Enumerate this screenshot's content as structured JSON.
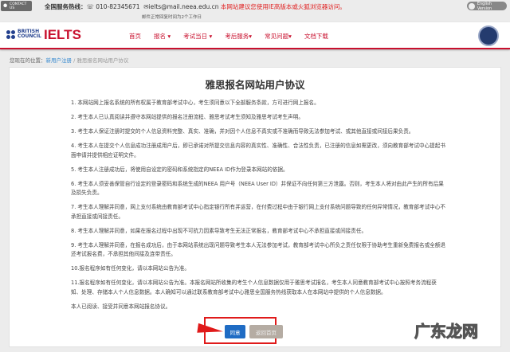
{
  "topbar": {
    "contact": "CONTACT US",
    "hotline_label": "全国服务热线：",
    "phone": "010-82345671",
    "email": "ielts@mail.neea.edu.cn",
    "browser_notice": "本网站建议您使用IE高版本或火狐浏览器访问。",
    "email_reply_note": "邮件正常回复时间为2个工作日",
    "english": "English Version"
  },
  "brand": {
    "council": "BRITISH\nCOUNCIL",
    "ielts": "IELTS"
  },
  "nav": {
    "items": [
      "首页",
      "报名 ▾",
      "考试当日 ▾",
      "考后服务▾",
      "常见问题▾",
      "文档下载"
    ]
  },
  "breadcrumb": {
    "label": "您现在的位置：",
    "link": "新用户注册",
    "sep": " / ",
    "current": "雅思报名网站用户协议"
  },
  "page": {
    "title": "雅思报名网站用户协议",
    "terms": [
      "1. 本网站网上报名系统的所有权属于教育部考试中心，考生须同意以下全部服务条款，方可进行网上报名。",
      "2. 考生本人已认真阅读并遵守本网站提供的报名注册流程、雅思考试考生须知及雅思考试考生声明。",
      "3. 考生本人保证注册时提交的个人信息资料完整、真实、准确，并对因个人信息不真实或不准确而导致无法参加考试、或其他直接或间接后果负责。",
      "4. 考生本人在提交个人信息成功注册成用户后，即已承诺对所提交信息内容的真实性、准确性、合法性负责，已注册的信息如需更改，须向教育部考试中心提起书面申请并提供相应证明文件。",
      "5. 考生本人注册成功后，将使用自设定的密码和系统指定的NEEA ID作为登录本网站的依据。",
      "6. 考生本人须妥善保管自行设定的登录密码和系统生成的NEEA 用户号（NEEA User ID）并保证不向任何第三方泄露。否则，考生本人将对由此产生的所有后果及损失负责。",
      "7. 考生本人理解并同意，网上支付系统由教育部考试中心指定银行所有并运营，在付费过程中由于银行网上支付系统问题导致的任何异常情况，教育部考试中心不承担直接或间接责任。",
      "8. 考生本人理解并同意，如果在报名过程中出现不可抗力因素导致考生无法正常报名，教育部考试中心不承担直接或间接责任。",
      "9. 考生本人理解并同意，在报名成功后，由于本网站系统出现问题导致考生本人无法参加考试，教育部考试中心所负之责任仅限于协助考生重新免费报名或全额退还考试报名费，不承担其他间接及连带责任。",
      "10.报名程序如有任何变化，请以本网站公告为准。",
      "11.报名程序如有任何变化，请以本网站公告为准。本报名网站所收集的考生个人信息数据仅用于雅思考试报名，考生本人同意教育部考试中心按照考务流程获知、处理、存储本人个人信息数据。本人确知可以通过联系教育部考试中心雅思全国服务热线获取本人在本网站中提供的个人信息数据。",
      "本人已阅读、接受并同意本网站报名协议。"
    ],
    "agree": "同意",
    "back": "返回首页"
  },
  "watermark": "广东龙网",
  "colors": {
    "brand_red": "#c8102e",
    "agree_blue": "#1f6cc4",
    "highlight": "#e01a1a"
  }
}
